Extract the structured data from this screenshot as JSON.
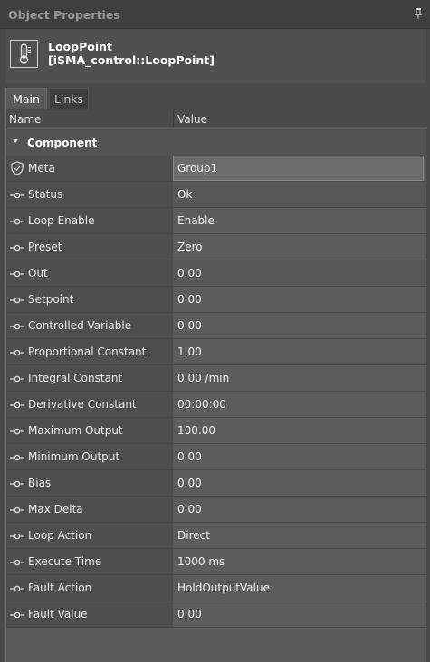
{
  "window": {
    "title": "Object Properties",
    "pin_icon": "pin-icon"
  },
  "object": {
    "name": "LoopPoint",
    "type": "[iSMA_control::LoopPoint]",
    "icon": "thermometer-icon"
  },
  "tabs": [
    {
      "label": "Main",
      "active": true
    },
    {
      "label": "Links",
      "active": false
    }
  ],
  "columns": {
    "name": "Name",
    "value": "Value"
  },
  "group": {
    "label": "Component",
    "expanded": true
  },
  "properties": [
    {
      "name": "Meta",
      "value": "Group1",
      "icon": "shield-icon",
      "state": "selected"
    },
    {
      "name": "Status",
      "value": "Ok",
      "icon": "slot-icon",
      "state": "readonly"
    },
    {
      "name": "Loop Enable",
      "value": "Enable",
      "icon": "slot-icon",
      "state": "editable"
    },
    {
      "name": "Preset",
      "value": "Zero",
      "icon": "slot-icon",
      "state": "editable"
    },
    {
      "name": "Out",
      "value": "0.00",
      "icon": "slot-icon",
      "state": "readonly"
    },
    {
      "name": "Setpoint",
      "value": "0.00",
      "icon": "slot-icon",
      "state": "editable"
    },
    {
      "name": "Controlled Variable",
      "value": "0.00",
      "icon": "slot-icon",
      "state": "editable"
    },
    {
      "name": "Proportional Constant",
      "value": "1.00",
      "icon": "slot-icon",
      "state": "editable"
    },
    {
      "name": "Integral Constant",
      "value": "0.00 /min",
      "icon": "slot-icon",
      "state": "editable"
    },
    {
      "name": "Derivative Constant",
      "value": "00:00:00",
      "icon": "slot-icon",
      "state": "editable"
    },
    {
      "name": "Maximum Output",
      "value": "100.00",
      "icon": "slot-icon",
      "state": "editable"
    },
    {
      "name": "Minimum Output",
      "value": "0.00",
      "icon": "slot-icon",
      "state": "editable"
    },
    {
      "name": "Bias",
      "value": "0.00",
      "icon": "slot-icon",
      "state": "editable"
    },
    {
      "name": "Max Delta",
      "value": "0.00",
      "icon": "slot-icon",
      "state": "editable"
    },
    {
      "name": "Loop Action",
      "value": "Direct",
      "icon": "slot-icon",
      "state": "editable"
    },
    {
      "name": "Execute Time",
      "value": "1000 ms",
      "icon": "slot-icon",
      "state": "editable"
    },
    {
      "name": "Fault Action",
      "value": "HoldOutputValue",
      "icon": "slot-icon",
      "state": "editable"
    },
    {
      "name": "Fault Value",
      "value": "0.00",
      "icon": "slot-icon",
      "state": "editable"
    }
  ],
  "colors": {
    "background": "#4a4a4a",
    "title_text": "#9a9a9a",
    "value_cell": "#5c5c5c",
    "name_cell": "#4e4e4e"
  }
}
